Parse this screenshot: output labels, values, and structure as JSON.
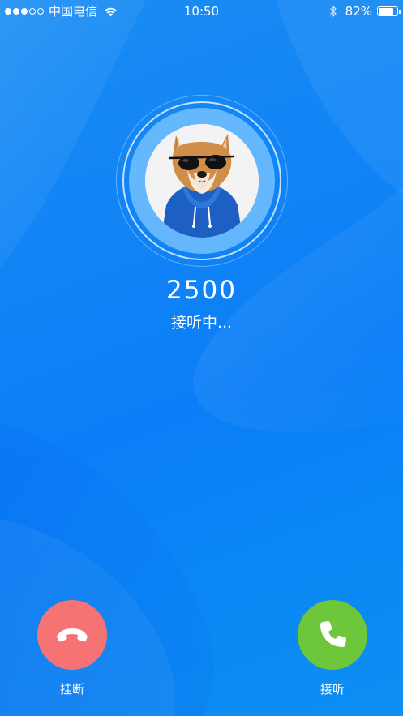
{
  "status_bar": {
    "signal_dots": [
      true,
      true,
      true,
      false,
      false
    ],
    "carrier": "中国电信",
    "time": "10:50",
    "battery_text": "82%",
    "battery_level": 0.82,
    "icons": [
      "wifi-icon",
      "bluetooth-icon",
      "battery-icon"
    ]
  },
  "caller": {
    "number": "2500",
    "status": "接听中..."
  },
  "actions": {
    "decline_label": "挂断",
    "answer_label": "接听"
  },
  "colors": {
    "background": "#1185f6",
    "decline": "#f57373",
    "answer": "#6ec63a",
    "ring": "#82c8ff"
  }
}
